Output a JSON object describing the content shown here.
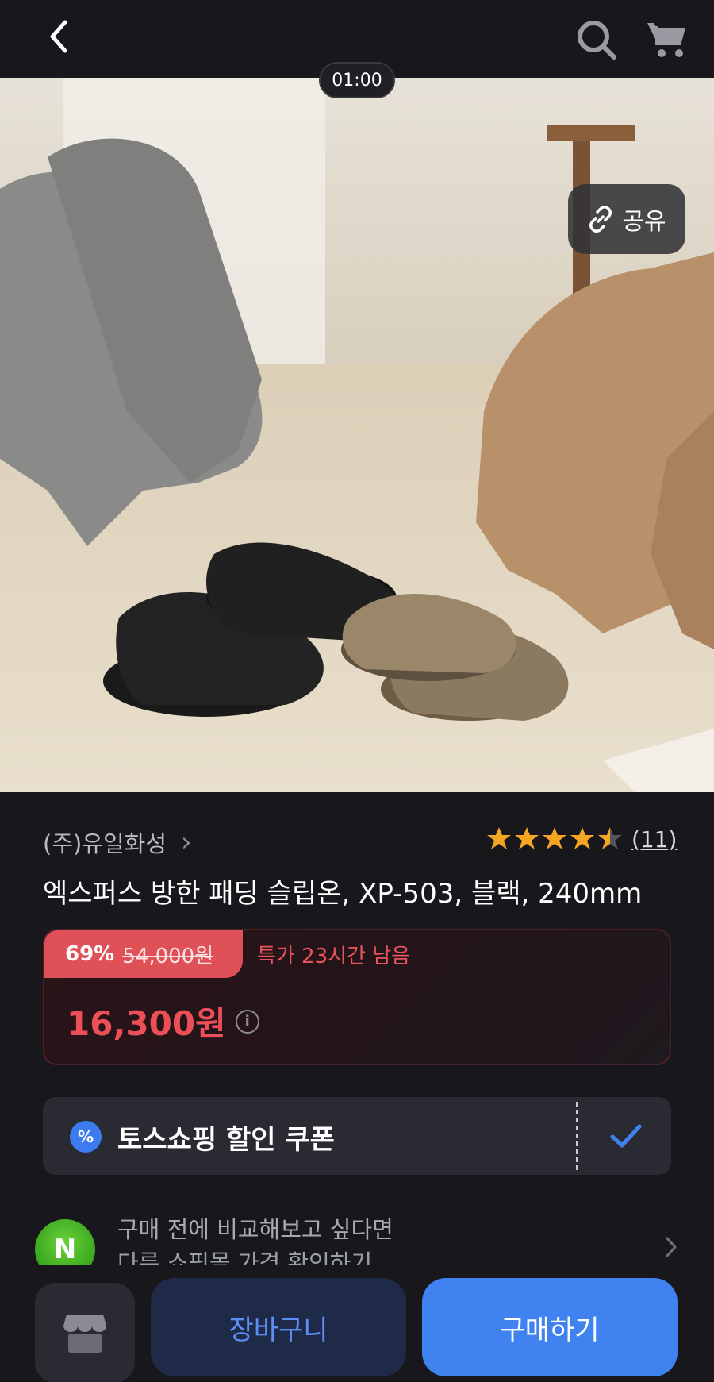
{
  "header": {
    "back_icon": "chevron-left-icon",
    "search_icon": "search-icon",
    "cart_icon": "cart-icon",
    "timer": "01:00"
  },
  "hero": {
    "share_label": "공유",
    "share_icon": "link-icon"
  },
  "product": {
    "brand": "(주)유일화성",
    "brand_chevron": "›",
    "rating": 4.5,
    "review_count": "(11)",
    "title": "엑스퍼스 방한 패딩 슬립온, XP-503, 블랙, 240mm"
  },
  "price": {
    "discount_percent": "69%",
    "original_price": "54,000원",
    "deal_text": "특가 23시간 남음",
    "sale_price": "16,300원",
    "info_icon": "i"
  },
  "coupon": {
    "badge": "%",
    "label": "토스쇼핑 할인 쿠폰",
    "checked": true
  },
  "compare": {
    "logo": "N",
    "line1": "구매 전에 비교해보고 싶다면",
    "line2": "다른 쇼핑몰 가격 확인하기"
  },
  "bottom": {
    "store_icon": "store-icon",
    "cart_label": "장바구니",
    "buy_label": "구매하기"
  },
  "colors": {
    "background": "#17171c",
    "accent_blue": "#3f82f0",
    "price_red": "#ec4f58",
    "star": "#f5a623"
  }
}
